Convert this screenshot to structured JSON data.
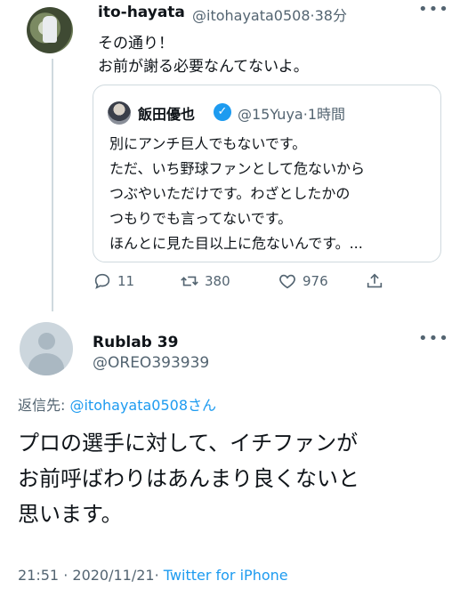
{
  "tweet": {
    "name": "ito-hayata",
    "handle": "@itohayata0508",
    "dot": "·",
    "time": "38分",
    "more_icon": "more-horizontal-icon",
    "lines": [
      "その通り！",
      "お前が謝る必要なんてないよ。"
    ],
    "quote": {
      "name": "飯田優也",
      "verified_icon": "verified-badge-icon",
      "handle": "@15Yuya",
      "dot": "·",
      "time": "1時間",
      "lines": [
        "別にアンチ巨人でもないです。",
        "ただ、いち野球ファンとして危ないから",
        "つぶやいただけです。わざとしたかの",
        "つもりでも言ってないです。",
        "ほんとに見た目以上に危ないんです。..."
      ]
    },
    "actions": {
      "reply_count": "11",
      "retweet_count": "380",
      "like_count": "976"
    }
  },
  "reply": {
    "name": "Rublab 39",
    "handle": "@OREO393939",
    "reply_label": "返信先: ",
    "reply_mention": "@itohayata0508",
    "reply_suffix": "さん",
    "lines": [
      "プロの選手に対して、イチファンが",
      "お前呼ばわりはあんまり良くないと",
      "思います。"
    ],
    "time": "21:51",
    "date": "2020/11/21",
    "source": "Twitter for iPhone",
    "dot": "·"
  },
  "colors": {
    "accent": "#1d9bf0",
    "secondary_text": "#536471",
    "border": "#cfd9de"
  }
}
